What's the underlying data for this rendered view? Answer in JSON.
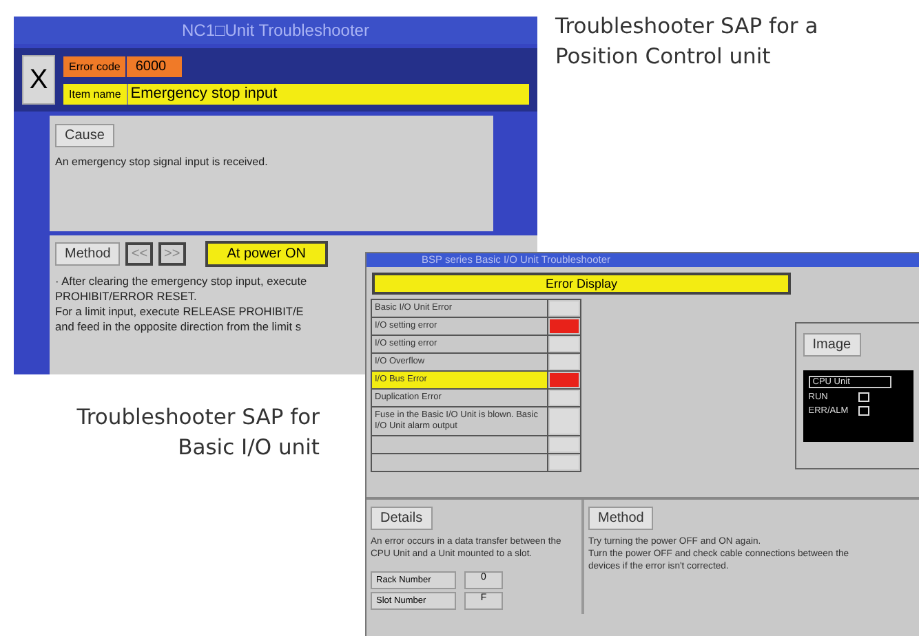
{
  "captions": [
    {
      "lines": [
        "Troubleshooter SAP for a",
        "Position Control unit"
      ]
    },
    {
      "lines": [
        "Troubleshooter SAP for",
        "Basic I/O unit"
      ]
    }
  ],
  "position_window": {
    "title": "NC1□Unit Troubleshooter",
    "close_label": "X",
    "error_code_label": "Error code",
    "error_code": "6000",
    "item_name_label": "Item name",
    "item_name": "Emergency stop input",
    "cause_tab": "Cause",
    "cause_text": "An emergency stop signal input is received.",
    "method_tab": "Method",
    "prev_label": "<<",
    "next_label": ">>",
    "power_button": "At power ON",
    "method_lines": [
      "· After clearing the emergency stop input, execute",
      "PROHIBIT/ERROR RESET.",
      "For a limit input, execute RELEASE PROHIBIT/E",
      "and feed in the opposite direction from the limit s"
    ]
  },
  "io_window": {
    "title": "BSP series Basic I/O Unit Troubleshooter",
    "error_display": "Error Display",
    "errors": [
      {
        "text": "Basic I/O Unit Error",
        "flagged": false,
        "selected": false
      },
      {
        "text": "I/O setting error",
        "flagged": true,
        "selected": false
      },
      {
        "text": "I/O setting error",
        "flagged": false,
        "selected": false
      },
      {
        "text": "I/O Overflow",
        "flagged": false,
        "selected": false
      },
      {
        "text": "I/O Bus Error",
        "flagged": true,
        "selected": true
      },
      {
        "text": "Duplication Error",
        "flagged": false,
        "selected": false
      },
      {
        "text": "Fuse in the Basic I/O Unit is blown. Basic I/O Unit alarm output",
        "flagged": false,
        "selected": false
      }
    ],
    "image_tab": "Image",
    "display": {
      "title": "CPU Unit",
      "rows": [
        "RUN",
        "ERR/ALM"
      ]
    },
    "details_tab": "Details",
    "details_text": "An error occurs in a data transfer between the CPU Unit and a Unit mounted to a slot.",
    "fields": [
      {
        "label": "Rack Number",
        "value": "0"
      },
      {
        "label": "Slot Number",
        "value": "F"
      }
    ],
    "method_tab": "Method",
    "method_lines": [
      "Try turning the power OFF and ON again.",
      "Turn the power OFF and check cable connections between the",
      "devices if the error isn't corrected."
    ]
  }
}
